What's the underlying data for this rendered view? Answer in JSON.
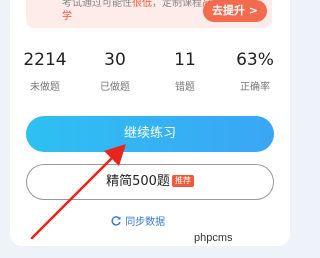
{
  "banner": {
    "text_1": "考试通过可能性",
    "text_hl_1": "很低",
    "text_2": "，定制课程",
    "text_hl_2": "高效学",
    "action_label": "去提升 >"
  },
  "stats": [
    {
      "value": "2214",
      "label": "未做题"
    },
    {
      "value": "30",
      "label": "已做题"
    },
    {
      "value": "11",
      "label": "错题"
    },
    {
      "value": "63%",
      "label": "正确率"
    }
  ],
  "buttons": {
    "continue_label": "继续练习",
    "selected_label": "精简500题",
    "selected_badge": "推荐"
  },
  "sync": {
    "label": "同步数据",
    "icon": "refresh-icon"
  },
  "watermark": "phpcms",
  "colors": {
    "primary": "#2ec0f2",
    "accent": "#f05a3c",
    "annotation_arrow": "#e8241f"
  }
}
